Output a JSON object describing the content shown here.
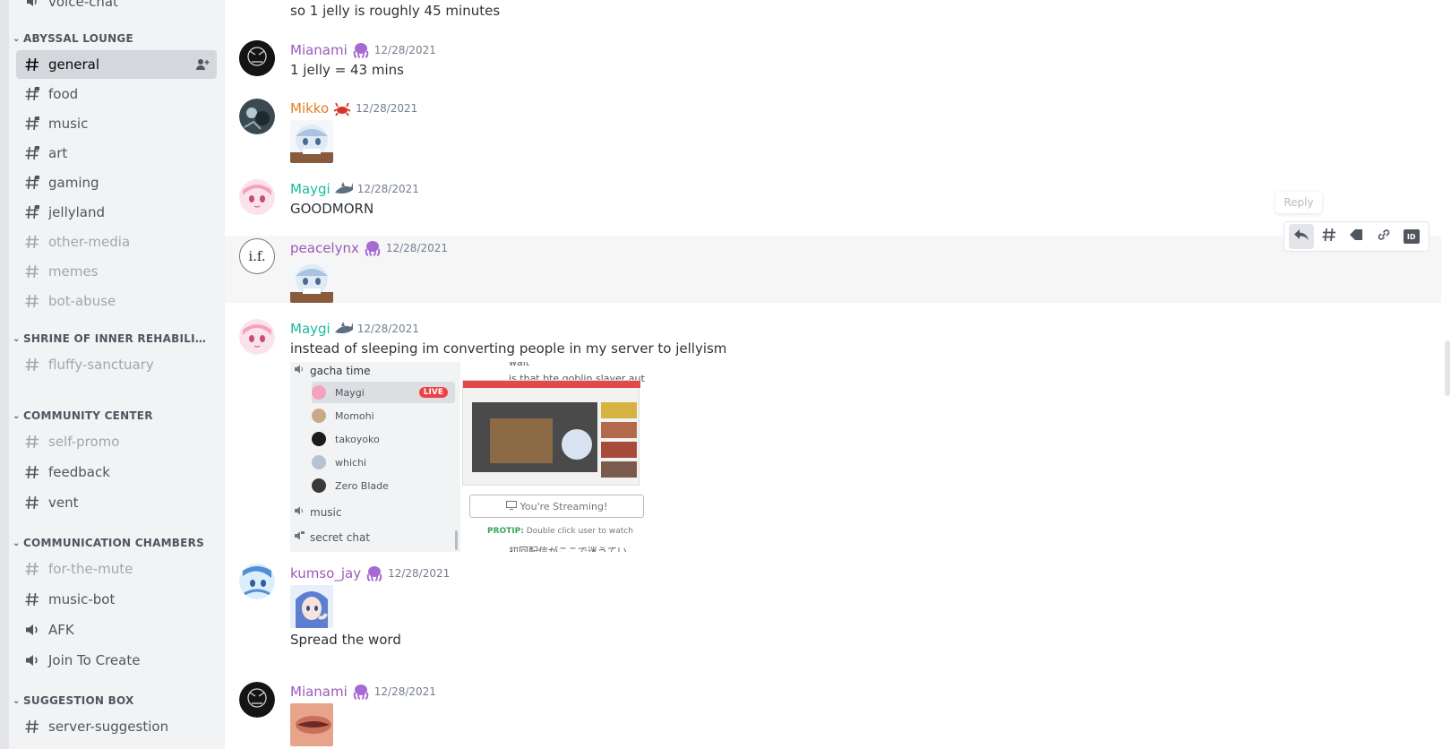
{
  "sidebar": {
    "top_partial": "voice-chat",
    "categories": [
      {
        "name": "ABYSSAL LOUNGE"
      },
      {
        "name": "SHRINE OF INNER REHABILITATI..."
      },
      {
        "name": "COMMUNITY CENTER"
      },
      {
        "name": "COMMUNICATION CHAMBERS"
      },
      {
        "name": "SUGGESTION BOX"
      }
    ],
    "channels": [
      {
        "name": "general"
      },
      {
        "name": "food"
      },
      {
        "name": "music"
      },
      {
        "name": "art"
      },
      {
        "name": "gaming"
      },
      {
        "name": "jellyland"
      },
      {
        "name": "other-media"
      },
      {
        "name": "memes"
      },
      {
        "name": "bot-abuse"
      },
      {
        "name": "fluffy-sanctuary"
      },
      {
        "name": "self-promo"
      },
      {
        "name": "feedback"
      },
      {
        "name": "vent"
      },
      {
        "name": "for-the-mute"
      },
      {
        "name": "music-bot"
      },
      {
        "name": "AFK"
      },
      {
        "name": "Join To Create"
      },
      {
        "name": "server-suggestion"
      }
    ]
  },
  "messages": {
    "top_text": "so 1 jelly is roughly 45 minutes",
    "m1": {
      "user": "Mianami",
      "time": "12/28/2021",
      "text": "1 jelly = 43 mins"
    },
    "m2": {
      "user": "Mikko",
      "time": "12/28/2021"
    },
    "m3": {
      "user": "Maygi",
      "time": "12/28/2021",
      "text": "GOODMORN"
    },
    "m4": {
      "user": "peacelynx",
      "time": "12/28/2021",
      "avatar_text": "i.f."
    },
    "m5": {
      "user": "Maygi",
      "time": "12/28/2021",
      "text": "instead of sleeping im converting people in my server to jellyism"
    },
    "m6": {
      "user": "kumso_jay",
      "time": "12/28/2021",
      "text": "Spread the word"
    },
    "m7": {
      "user": "Mianami",
      "time": "12/28/2021"
    }
  },
  "embed": {
    "voice_channel": "gacha time",
    "users": [
      "Maygi",
      "Momohi",
      "takoyoko",
      "whichi",
      "Zero Blade"
    ],
    "live_label": "LIVE",
    "channel_music": "music",
    "channel_secret": "secret chat",
    "snippet_wait": "wait",
    "snippet_goblin": "is that bte goblin slayer aut",
    "streaming_label": "You're Streaming!",
    "protip_label": "PROTIP:",
    "protip_text": "Double click user to watch",
    "bottom_snippet": "初回配信がここで迷うてい"
  },
  "toolbar": {
    "tooltip": "Reply",
    "id_label": "ID"
  },
  "colors": {
    "purple_user": "#9b59b6",
    "orange_user": "#e67e22",
    "teal_user": "#1abc9c",
    "active_channel": "#d4d7dc"
  }
}
